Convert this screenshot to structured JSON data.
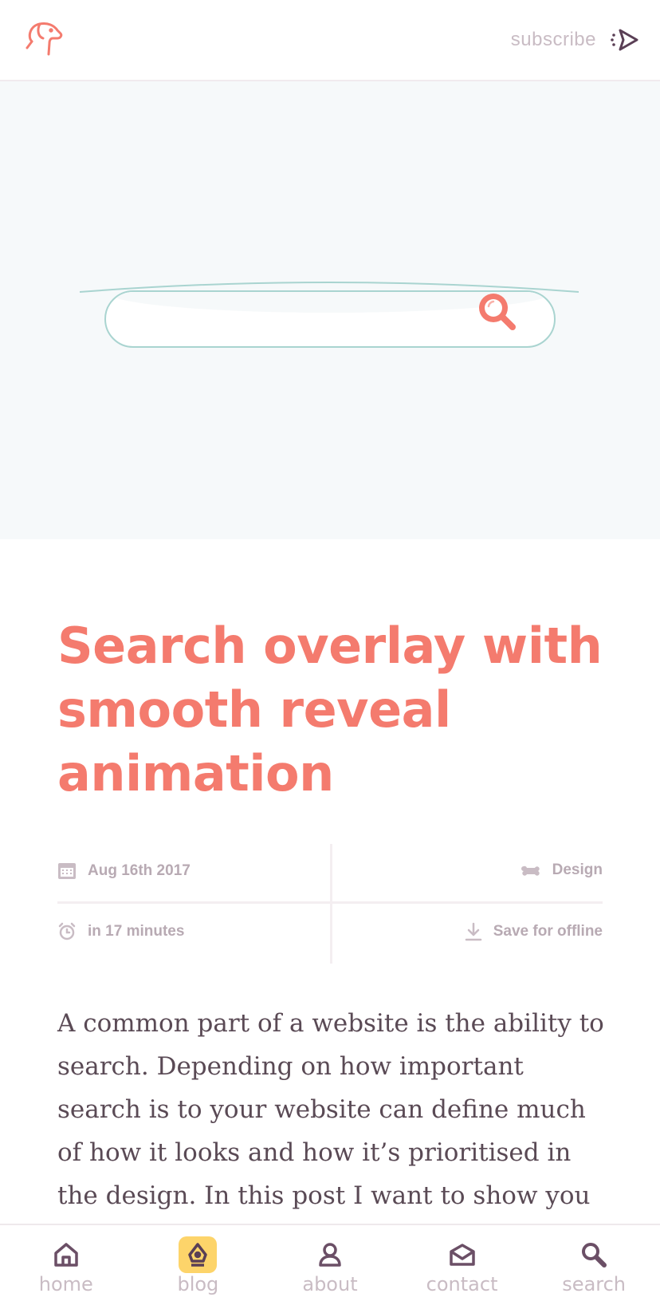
{
  "header": {
    "logo_icon": "dog-head-icon",
    "subscribe_label": "subscribe",
    "subscribe_icon": "send-icon"
  },
  "hero": {
    "search_icon": "search-icon",
    "search_value": ""
  },
  "article": {
    "title": "Search overlay with smooth reveal animation",
    "meta": {
      "date": "Aug 16th 2017",
      "category": "Design",
      "read_time": "in 17 minutes",
      "save_label": "Save for offline"
    },
    "body": "A common part of a website is the ability to search. Depending on how important search is to your website can define much of how it looks and how it’s prioritised in the design. In this post I want to show you how to create a"
  },
  "nav": {
    "items": [
      {
        "label": "home",
        "icon": "home-icon",
        "active": false
      },
      {
        "label": "blog",
        "icon": "pen-nib-icon",
        "active": true
      },
      {
        "label": "about",
        "icon": "person-icon",
        "active": false
      },
      {
        "label": "contact",
        "icon": "mail-icon",
        "active": false
      },
      {
        "label": "search",
        "icon": "search-icon",
        "active": false
      }
    ]
  },
  "colors": {
    "accent": "#f47b6e",
    "hero_bg": "#f6f9fa",
    "teal_outline": "#a9d4d0",
    "muted_text": "#c9bcc4",
    "dark_icon": "#5a3f55",
    "blog_highlight": "#fdd46a"
  }
}
